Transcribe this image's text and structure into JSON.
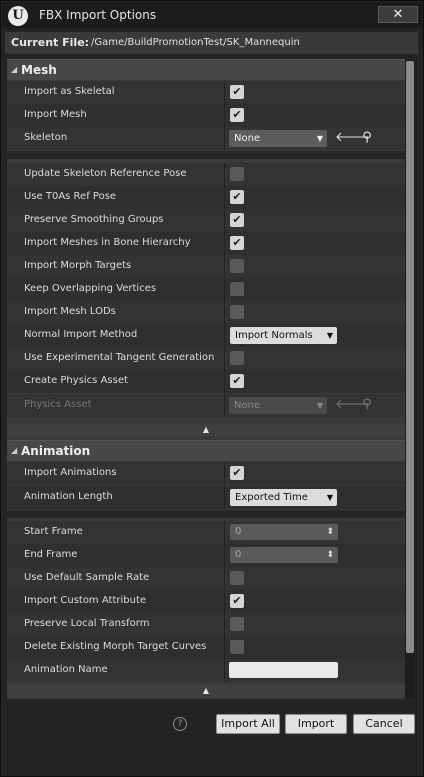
{
  "window": {
    "title": "FBX Import Options",
    "close_icon": "✕"
  },
  "current_file": {
    "label": "Current File:",
    "path": "/Game/BuildPromotionTest/SK_Mannequin"
  },
  "mesh": {
    "title": "Mesh",
    "import_as_skeletal": {
      "label": "Import as Skeletal",
      "checked": true
    },
    "import_mesh": {
      "label": "Import Mesh",
      "checked": true
    },
    "skeleton": {
      "label": "Skeleton",
      "value": "None"
    },
    "update_skeleton_ref_pose": {
      "label": "Update Skeleton Reference Pose",
      "checked": false
    },
    "use_t0_ref_pose": {
      "label": "Use T0As Ref Pose",
      "checked": true
    },
    "preserve_smoothing_groups": {
      "label": "Preserve Smoothing Groups",
      "checked": true
    },
    "import_meshes_in_bone_hierarchy": {
      "label": "Import Meshes in Bone Hierarchy",
      "checked": true
    },
    "import_morph_targets": {
      "label": "Import Morph Targets",
      "checked": false
    },
    "keep_overlapping_vertices": {
      "label": "Keep Overlapping Vertices",
      "checked": false
    },
    "import_mesh_lods": {
      "label": "Import Mesh LODs",
      "checked": false
    },
    "normal_import_method": {
      "label": "Normal Import Method",
      "value": "Import Normals"
    },
    "use_experimental_tangent_generation": {
      "label": "Use Experimental Tangent Generation",
      "checked": false
    },
    "create_physics_asset": {
      "label": "Create Physics Asset",
      "checked": true
    },
    "physics_asset": {
      "label": "Physics Asset",
      "value": "None"
    }
  },
  "animation": {
    "title": "Animation",
    "import_animations": {
      "label": "Import Animations",
      "checked": true
    },
    "animation_length": {
      "label": "Animation Length",
      "value": "Exported Time"
    },
    "start_frame": {
      "label": "Start Frame",
      "value": "0"
    },
    "end_frame": {
      "label": "End Frame",
      "value": "0"
    },
    "use_default_sample_rate": {
      "label": "Use Default Sample Rate",
      "checked": false
    },
    "import_custom_attribute": {
      "label": "Import Custom Attribute",
      "checked": true
    },
    "preserve_local_transform": {
      "label": "Preserve Local Transform",
      "checked": false
    },
    "delete_existing_morph_target_curves": {
      "label": "Delete Existing Morph Target Curves",
      "checked": false
    },
    "animation_name": {
      "label": "Animation Name",
      "value": ""
    }
  },
  "buttons": {
    "import_all": "Import All",
    "import": "Import",
    "cancel": "Cancel"
  },
  "glyphs": {
    "check": "✔",
    "dropdown": "▼",
    "expand": "▲",
    "collapse": "◢",
    "help": "?",
    "use_asset": "🡐",
    "browse": "⚲",
    "spin_grip": "⬍"
  }
}
